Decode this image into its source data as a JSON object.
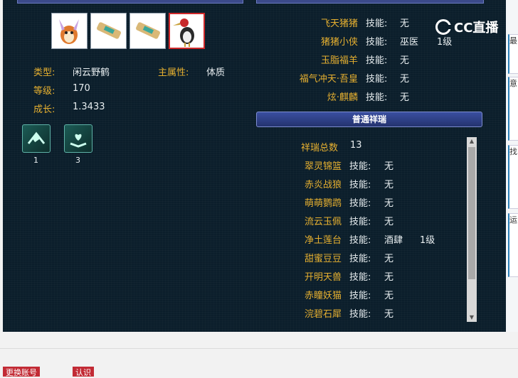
{
  "logo": {
    "text": "CC直播"
  },
  "pet": {
    "type_label": "类型:",
    "type_value": "闲云野鹤",
    "attr_label": "主属性:",
    "attr_value": "体质",
    "level_label": "等级:",
    "level_value": "170",
    "growth_label": "成长:",
    "growth_value": "1.3433"
  },
  "badges": [
    {
      "count": "1",
      "icon": "scroll-icon"
    },
    {
      "count": "3",
      "icon": "heart-shield-icon"
    }
  ],
  "right_top": [
    {
      "name": "飞天猪猪",
      "skill_label": "技能:",
      "skill": "无",
      "level": ""
    },
    {
      "name": "猪猪小侠",
      "skill_label": "技能:",
      "skill": "巫医",
      "level": "1级"
    },
    {
      "name": "玉脂福羊",
      "skill_label": "技能:",
      "skill": "无",
      "level": ""
    },
    {
      "name": "福气冲天·吾皇",
      "skill_label": "技能:",
      "skill": "无",
      "level": ""
    },
    {
      "name": "炫·麒麟",
      "skill_label": "技能:",
      "skill": "无",
      "level": ""
    }
  ],
  "section_title": "普通祥瑞",
  "total_label": "祥瑞总数",
  "total_value": "13",
  "list": [
    {
      "name": "翠灵锦篮",
      "skill_label": "技能:",
      "skill": "无",
      "level": ""
    },
    {
      "name": "赤炎战狼",
      "skill_label": "技能:",
      "skill": "无",
      "level": ""
    },
    {
      "name": "萌萌鹦鹉",
      "skill_label": "技能:",
      "skill": "无",
      "level": ""
    },
    {
      "name": "流云玉佩",
      "skill_label": "技能:",
      "skill": "无",
      "level": ""
    },
    {
      "name": "净土莲台",
      "skill_label": "技能:",
      "skill": "酒肆",
      "level": "1级"
    },
    {
      "name": "甜蜜豆豆",
      "skill_label": "技能:",
      "skill": "无",
      "level": ""
    },
    {
      "name": "开明天兽",
      "skill_label": "技能:",
      "skill": "无",
      "level": ""
    },
    {
      "name": "赤瞳妖猫",
      "skill_label": "技能:",
      "skill": "无",
      "level": ""
    },
    {
      "name": "浣碧石犀",
      "skill_label": "技能:",
      "skill": "无",
      "level": ""
    }
  ],
  "side_tabs": [
    "最",
    "意",
    "找",
    "运"
  ],
  "bottom_buttons": [
    "更换账号",
    "认识"
  ]
}
